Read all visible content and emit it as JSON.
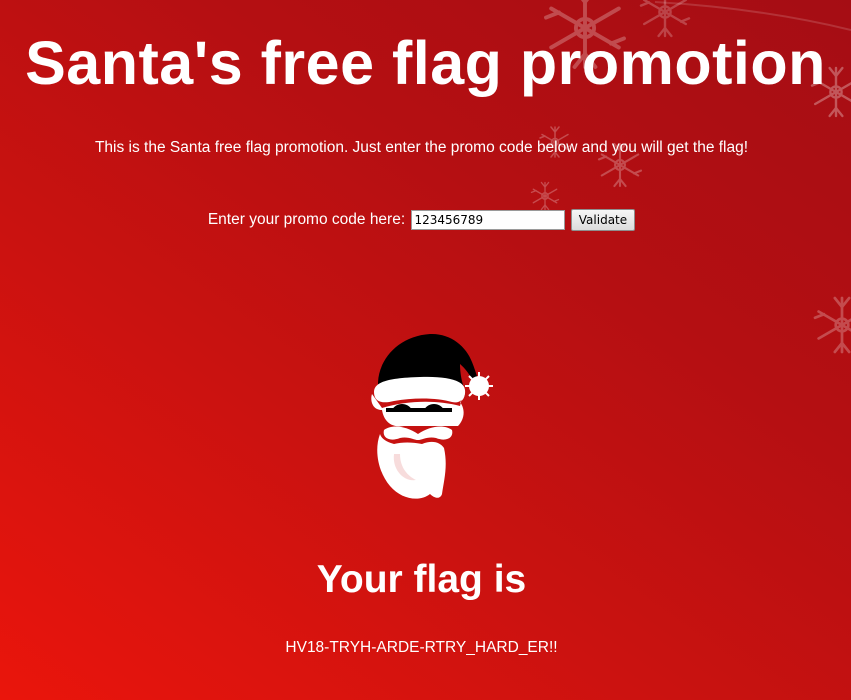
{
  "page": {
    "title": "Santa's free flag promotion",
    "intro": "This is the Santa free flag promotion. Just enter the promo code below and you will get the flag!"
  },
  "promo_form": {
    "label": "Enter your promo code here:",
    "input_value": "123456789",
    "button_label": "Validate"
  },
  "result": {
    "heading": "Your flag is",
    "flag": "HV18-TRYH-ARDE-RTRY_HARD_ER!!"
  },
  "icons": {
    "santa": "santa-face-icon",
    "background": "snowflake-icon"
  },
  "colors": {
    "background_light": "#ea150c",
    "background_dark": "#a50d14",
    "text": "#ffffff",
    "santa_hat": "#000000"
  }
}
